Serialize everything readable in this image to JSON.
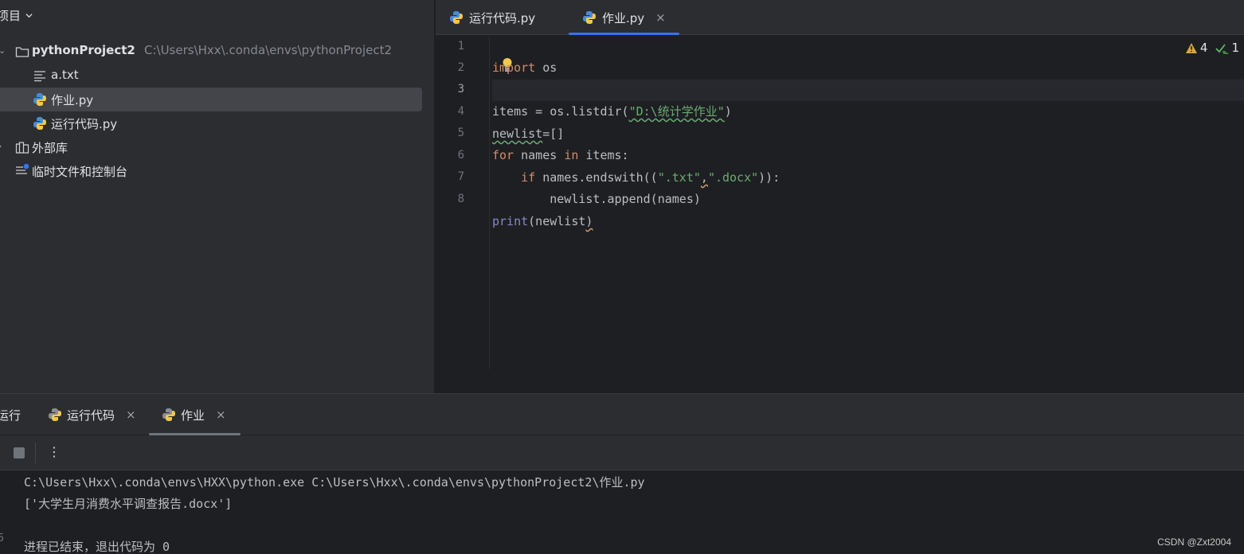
{
  "project_panel": {
    "title": "项目",
    "tree": [
      {
        "label": "pythonProject2",
        "path": "C:\\Users\\Hxx\\.conda\\envs\\pythonProject2",
        "icon": "folder-icon",
        "expanded": true
      },
      {
        "label": "a.txt",
        "icon": "text-file-icon"
      },
      {
        "label": "作业.py",
        "icon": "python-icon",
        "selected": true
      },
      {
        "label": "运行代码.py",
        "icon": "python-icon"
      },
      {
        "label": "外部库",
        "icon": "library-icon",
        "expanded": false
      },
      {
        "label": "临时文件和控制台",
        "icon": "scratch-icon"
      }
    ]
  },
  "editor": {
    "tabs": [
      {
        "label": "运行代码.py",
        "active": false
      },
      {
        "label": "作业.py",
        "active": true,
        "close": "×"
      }
    ],
    "line_numbers": [
      "1",
      "2",
      "3",
      "4",
      "5",
      "6",
      "7",
      "8"
    ],
    "current_line": 3,
    "inspections": {
      "warnings": "4",
      "checks": "1"
    },
    "code": {
      "l1_kw": "import",
      "l1_rest": " os",
      "l3_a": "items = os.listdir(",
      "l3_str": "\"D:\\统计学作业\"",
      "l3_b": ")",
      "l4_a": "newlist",
      "l4_b": "=[]",
      "l5_kw1": "for",
      "l5_a": " names ",
      "l5_kw2": "in",
      "l5_b": " items:",
      "l6_indent": "    ",
      "l6_kw": "if",
      "l6_a": " names.endswith((",
      "l6_s1": "\".txt\"",
      "l6_comma": ",",
      "l6_s2": "\".docx\"",
      "l6_b": ")):",
      "l7": "        newlist.append(names)",
      "l8_bi": "print",
      "l8_a": "(newlist",
      "l8_b": ")"
    }
  },
  "run_window": {
    "title": "运行",
    "tabs": [
      {
        "label": "运行代码",
        "close": "×"
      },
      {
        "label": "作业",
        "close": "×",
        "active": true
      }
    ],
    "more": "⋮",
    "console_lines": [
      "C:\\Users\\Hxx\\.conda\\envs\\HXX\\python.exe C:\\Users\\Hxx\\.conda\\envs\\pythonProject2\\作业.py",
      "['大学生月消费水平调查报告.docx']",
      "",
      "进程已结束，退出代码为 0"
    ],
    "gutter_mark": "5"
  },
  "watermark": "CSDN @Zxt2004"
}
